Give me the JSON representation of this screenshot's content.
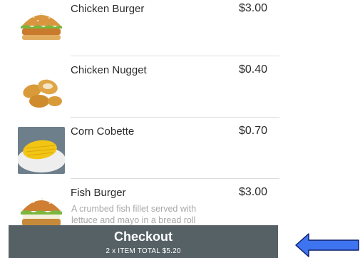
{
  "menu": {
    "items": [
      {
        "name": "Chicken Burger",
        "price": "$3.00",
        "description": "",
        "image": "chicken-burger-photo"
      },
      {
        "name": "Chicken Nugget",
        "price": "$0.40",
        "description": "",
        "image": "chicken-nugget-photo"
      },
      {
        "name": "Corn Cobette",
        "price": "$0.70",
        "description": "",
        "image": "corn-cobette-photo"
      },
      {
        "name": "Fish Burger",
        "price": "$3.00",
        "description": "A crumbed fish fillet served with lettuce and mayo in a bread roll",
        "image": "fish-burger-photo"
      }
    ]
  },
  "checkout": {
    "title": "Checkout",
    "summary": "2 x ITEM  TOTAL $5.20"
  },
  "colors": {
    "checkout_bar": "#566166",
    "arrow": "#3f74f0"
  },
  "icons": {
    "pointer": "arrow-left-icon"
  }
}
